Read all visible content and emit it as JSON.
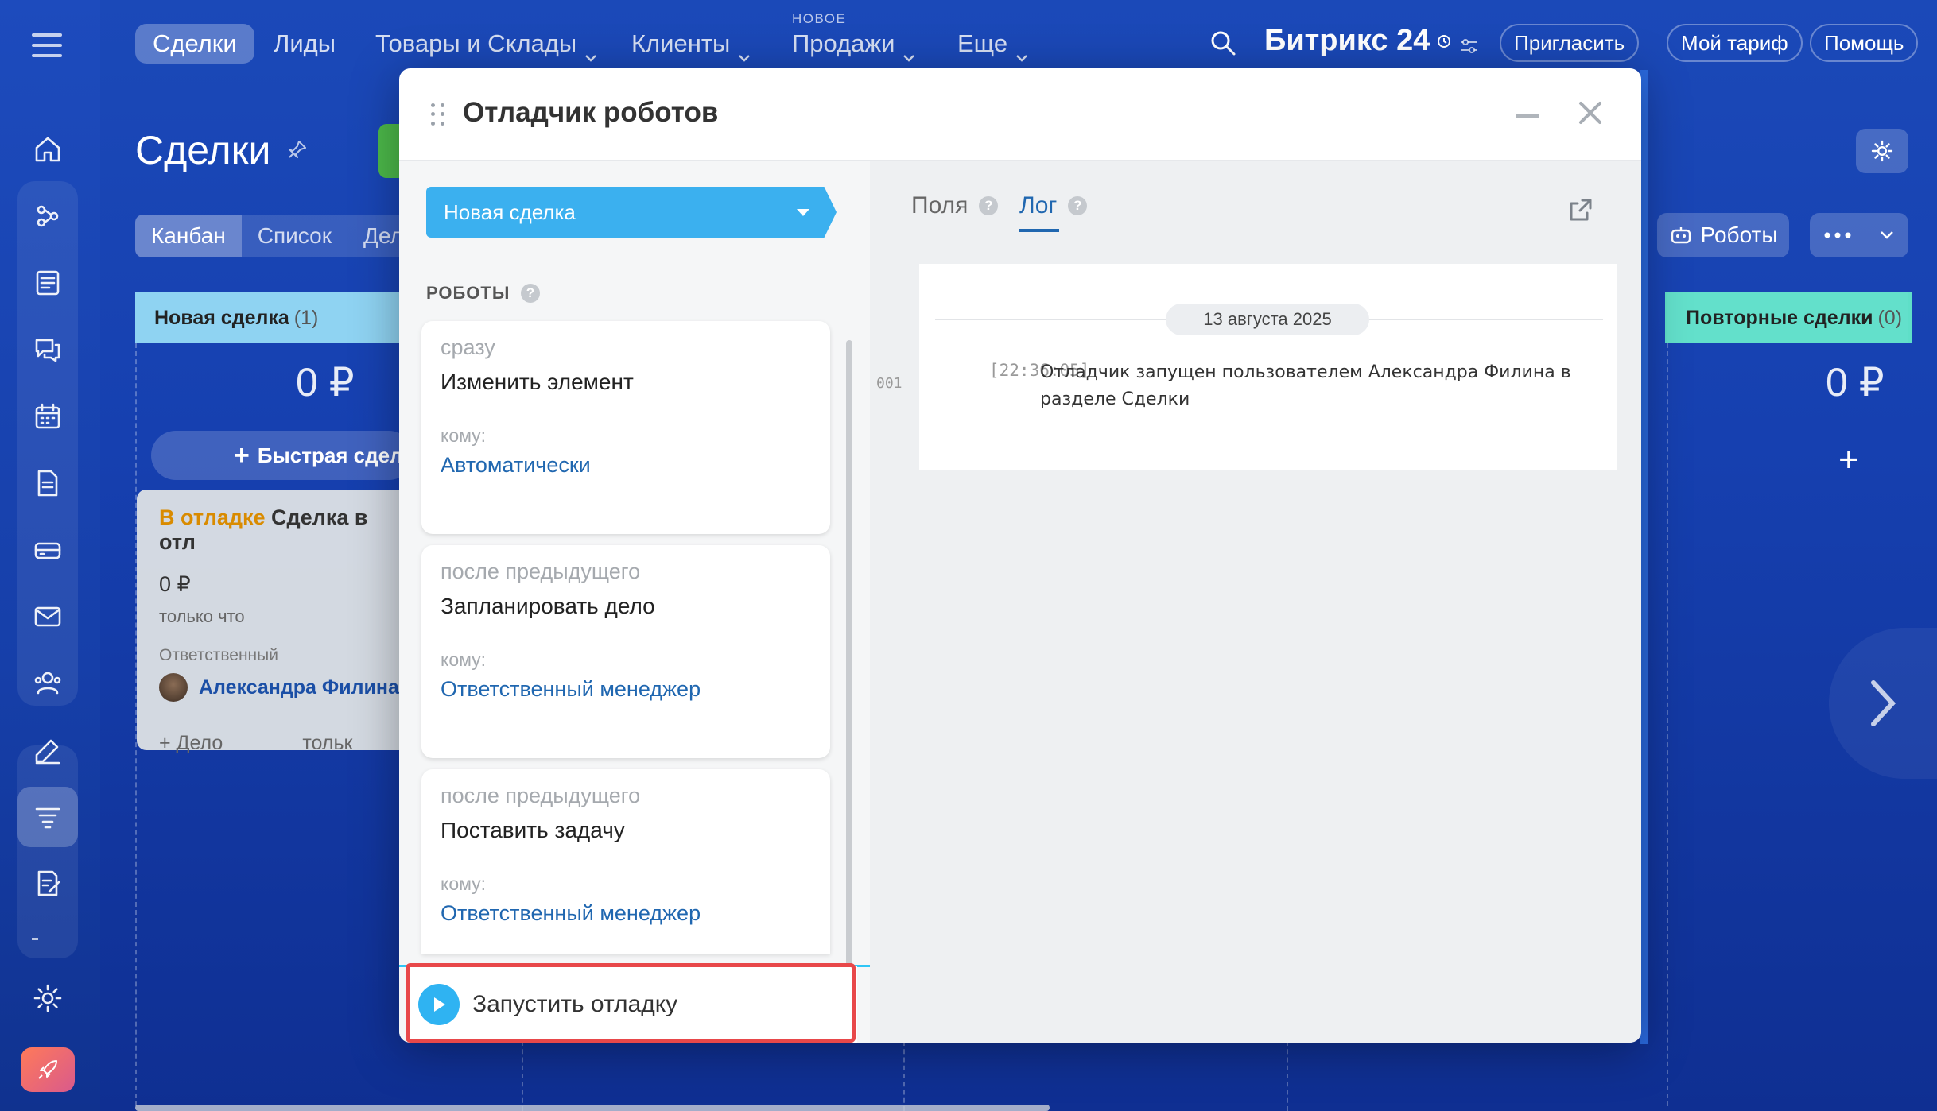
{
  "topbar": {
    "nav": [
      {
        "label": "Сделки",
        "active": true
      },
      {
        "label": "Лиды"
      },
      {
        "label": "Товары и Склады",
        "dropdown": true
      },
      {
        "label": "Клиенты",
        "dropdown": true
      },
      {
        "label": "Продажи",
        "dropdown": true,
        "tag": "НОВОЕ"
      },
      {
        "label": "Еще",
        "dropdown": true
      }
    ],
    "brand": "Битрикс 24",
    "invite": "Пригласить",
    "tariff": "Мой тариф",
    "help": "Помощь"
  },
  "page": {
    "title": "Сделки",
    "view_tabs": [
      "Канбан",
      "Список",
      "Дел"
    ],
    "robots_button": "Роботы"
  },
  "kanban": {
    "columns": [
      {
        "title": "Новая сделка",
        "count": "(1)",
        "sum": "0 ₽"
      },
      {
        "title": "Повторные сделки",
        "count": "(0)",
        "sum": "0 ₽"
      }
    ],
    "quick_add": "Быстрая сдел",
    "card": {
      "status": "В отладке",
      "title": "Сделка в отл",
      "sum": "0 ₽",
      "time": "только что",
      "resp_label": "Ответственный",
      "user": "Александра Филина",
      "add_task": "+ Дело",
      "foot_time": "тольк"
    }
  },
  "modal": {
    "title": "Отладчик роботов",
    "stage": "Новая сделка",
    "robots_label": "РОБОТЫ",
    "robots": [
      {
        "when": "сразу",
        "action": "Изменить элемент",
        "to_label": "кому:",
        "to": "Автоматически"
      },
      {
        "when": "после предыдущего",
        "action": "Запланировать дело",
        "to_label": "кому:",
        "to": "Ответственный менеджер"
      },
      {
        "when": "после предыдущего",
        "action": "Поставить задачу",
        "to_label": "кому:",
        "to": "Ответственный менеджер"
      }
    ],
    "run_button": "Запустить отладку",
    "tabs": {
      "fields": "Поля",
      "log": "Лог"
    },
    "log": {
      "date": "13 августа 2025",
      "line_no": "001",
      "time": "[22:36:05]",
      "message": "Отладчик запущен пользователем Александра Филина в разделе Сделки"
    }
  },
  "colors": {
    "accent": "#3bb0ef",
    "link": "#2067b0",
    "highlight": "#e8484a",
    "debug_status": "#d98b00"
  }
}
